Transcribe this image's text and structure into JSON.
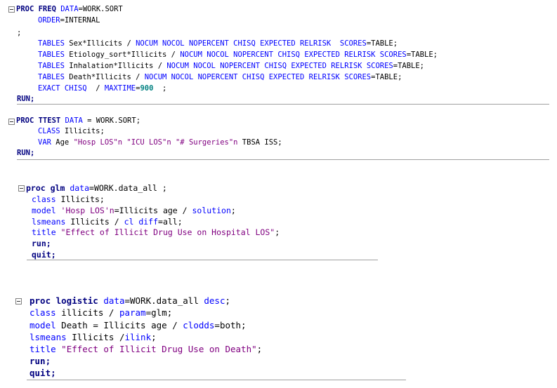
{
  "freq": {
    "proc": "PROC FREQ",
    "data_kw": "DATA",
    "data_val": "=WORK.SORT",
    "order_kw": "ORDER",
    "order_val": "=INTERNAL",
    "semicolon": ";",
    "tables": [
      {
        "kw": "TABLES",
        "vars": " Sex*Illicits / ",
        "opts": "NOCUM NOCOL NOPERCENT CHISQ EXPECTED RELRISK  SCORES",
        "end": "=TABLE;"
      },
      {
        "kw": "TABLES",
        "vars": " Etiology_sort*Illicits / ",
        "opts": "NOCUM NOCOL NOPERCENT CHISQ EXPECTED RELRISK SCORES",
        "end": "=TABLE;"
      },
      {
        "kw": "TABLES",
        "vars": " Inhalation*Illicits / ",
        "opts": "NOCUM NOCOL NOPERCENT CHISQ EXPECTED RELRISK SCORES",
        "end": "=TABLE;"
      },
      {
        "kw": "TABLES",
        "vars": " Death*Illicits / ",
        "opts": "NOCUM NOCOL NOPERCENT CHISQ EXPECTED RELRISK SCORES",
        "end": "=TABLE;"
      }
    ],
    "exact_kw": "EXACT CHISQ",
    "exact_sep": "  / ",
    "maxtime_kw": "MAXTIME",
    "maxtime_eq": "=",
    "maxtime_val": "900",
    "exact_end": "  ;",
    "run": "RUN;"
  },
  "ttest": {
    "proc": "PROC TTEST",
    "data_kw": "DATA",
    "data_val": " = WORK.SORT;",
    "class_kw": "CLASS",
    "class_val": " Illicits;",
    "var_kw": "VAR",
    "var_pre": " Age ",
    "var_strs": "\"Hosp LOS\"n \"ICU LOS\"n \"# Surgeries\"n",
    "var_post": " TBSA ISS;",
    "run": "RUN;"
  },
  "glm": {
    "proc": "proc glm",
    "data_kw": "data",
    "data_val": "=WORK.data_all ;",
    "class_kw": "class",
    "class_val": " Illicits;",
    "model_kw": "model",
    "model_str": " 'Hosp LOS'n",
    "model_rest": "=Illicits age / ",
    "solution_kw": "solution",
    "model_end": ";",
    "lsmeans_kw": "lsmeans",
    "lsmeans_val": " Illicits / ",
    "cl_kw": "cl diff",
    "lsmeans_end": "=all;",
    "title_kw": "title",
    "title_str": " \"Effect of Illicit Drug Use on Hospital LOS\"",
    "title_end": ";",
    "run": "run;",
    "quit": "quit;"
  },
  "logistic": {
    "proc": "proc logistic",
    "data_kw": "data",
    "data_val": "=WORK.data_all ",
    "desc_kw": "desc",
    "desc_end": ";",
    "class_kw": "class",
    "class_val": " illicits / ",
    "param_kw": "param",
    "param_end": "=glm;",
    "model_kw": "model",
    "model_val": " Death = Illicits age / ",
    "clodds_kw": "clodds",
    "model_end": "=both;",
    "lsmeans_kw": "lsmeans",
    "lsmeans_val": " Illicits /",
    "ilink_kw": "ilink",
    "lsmeans_end": ";",
    "title_kw": "title",
    "title_str": " \"Effect of Illicit Drug Use on Death\"",
    "title_end": ";",
    "run": "run;",
    "quit": "quit;"
  }
}
